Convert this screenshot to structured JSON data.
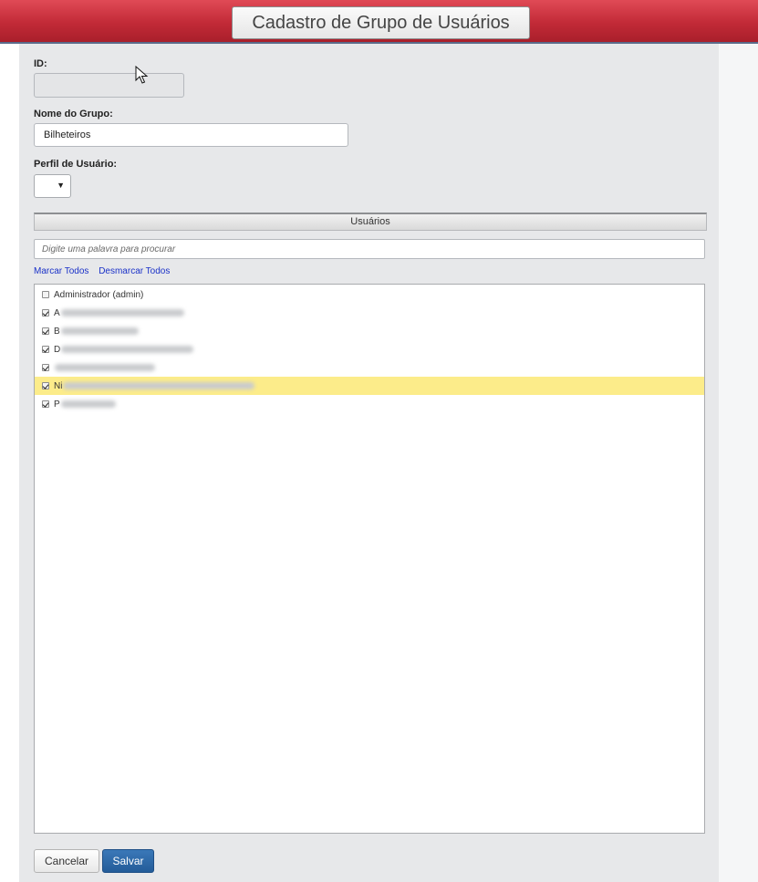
{
  "header": {
    "title": "Cadastro de Grupo de Usuários"
  },
  "form": {
    "id_label": "ID:",
    "id_value": "",
    "name_label": "Nome do Grupo:",
    "name_value": "Bilheteiros",
    "profile_label": "Perfil de Usuário:",
    "profile_value": ""
  },
  "users": {
    "section_title": "Usuários",
    "search_placeholder": "Digite uma palavra para procurar",
    "select_all": "Marcar Todos",
    "deselect_all": "Desmarcar Todos",
    "items": [
      {
        "visible_text": "Administrador (admin)",
        "checked": false,
        "highlighted": false
      },
      {
        "visible_text": "A",
        "checked": true,
        "highlighted": false
      },
      {
        "visible_text": "B",
        "checked": true,
        "highlighted": false
      },
      {
        "visible_text": "D",
        "checked": true,
        "highlighted": false
      },
      {
        "visible_text": "",
        "checked": true,
        "highlighted": false
      },
      {
        "visible_text": "Ni",
        "checked": true,
        "highlighted": true
      },
      {
        "visible_text": "P",
        "checked": true,
        "highlighted": false
      }
    ]
  },
  "actions": {
    "cancel": "Cancelar",
    "save": "Salvar"
  },
  "colors": {
    "header_red": "#c22a37",
    "highlight": "#fcec8a",
    "primary_button": "#2d6aa8",
    "link": "#1a31c8"
  },
  "icons": {
    "cursor": "mouse-pointer-icon",
    "dropdown": "caret-down-icon",
    "checkbox": "checkbox-icon"
  }
}
